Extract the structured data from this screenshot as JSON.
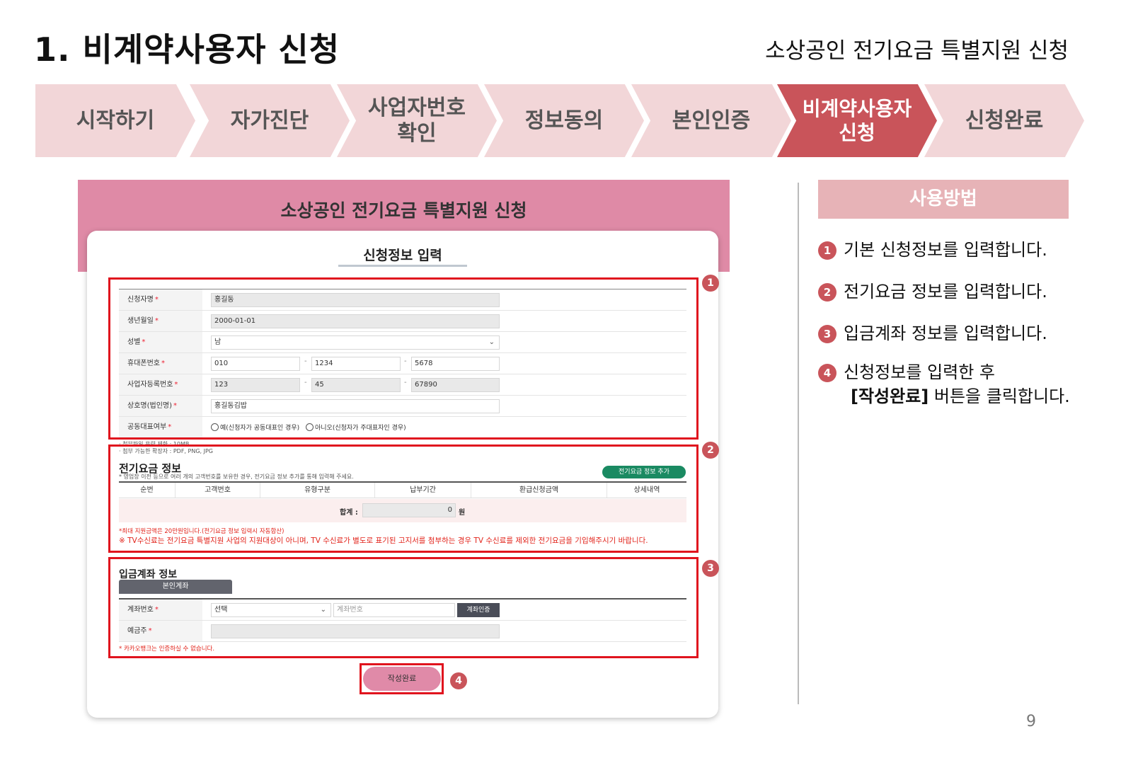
{
  "slide": {
    "title": "1. 비계약사용자 신청",
    "subtitle": "소상공인 전기요금 특별지원 신청",
    "page_number": "9"
  },
  "steps": [
    {
      "line1": "시작하기",
      "line2": "",
      "active": false
    },
    {
      "line1": "자가진단",
      "line2": "",
      "active": false
    },
    {
      "line1": "사업자번호",
      "line2": "확인",
      "active": false
    },
    {
      "line1": "정보동의",
      "line2": "",
      "active": false
    },
    {
      "line1": "본인인증",
      "line2": "",
      "active": false
    },
    {
      "line1": "비계약사용자",
      "line2": "신청",
      "active": true
    },
    {
      "line1": "신청완료",
      "line2": "",
      "active": false
    }
  ],
  "screenshot": {
    "header_title": "소상공인 전기요금 특별지원 신청",
    "card_title": "신청정보 입력",
    "applicant": {
      "name_label": "신청자명",
      "name_value": "홍길동",
      "birth_label": "생년월일",
      "birth_value": "2000-01-01",
      "gender_label": "성별",
      "gender_value": "남",
      "phone_label": "휴대폰번호",
      "phone_1": "010",
      "phone_2": "1234",
      "phone_3": "5678",
      "bizno_label": "사업자등록번호",
      "bizno_1": "123",
      "bizno_2": "45",
      "bizno_3": "67890",
      "company_label": "상호명(법인명)",
      "company_value": "홍길동김밥",
      "corep_label": "공동대표여부",
      "corep_yes": "예(신청자가 공동대표인 경우)",
      "corep_no": "아니오(신청자가 주대표자인 경우)",
      "required_mark": "*",
      "dash": "-"
    },
    "attach_notes": [
      "· 첨부파일 용량 제한 : 10MB",
      "· 첨부 가능한 확장자 : PDF, PNG, JPG"
    ],
    "electric": {
      "title": "전기요금 정보",
      "note": "* 영업장 이전 등으로 여러 개의 고객번호를 보유한 경우, 전기요금 정보 추가를 통해 입력해 주세요.",
      "add_button": "전기요금 정보 추가",
      "columns": [
        "순번",
        "고객번호",
        "유형구분",
        "납부기간",
        "환급신청금액",
        "상세내역"
      ],
      "total_label": "합계 :",
      "total_value": "0",
      "total_unit": "원",
      "max_note": "*최대 지원금액은 20만원입니다.(전기요금 정보 입력시 자동합산)",
      "tv_note": "※ TV수신료는 전기요금 특별지원 사업의 지원대상이 아니며, TV 수신료가 별도로 표기된 고지서를 첨부하는 경우 TV 수신료를 제외한 전기요금을 기입해주시기 바랍니다."
    },
    "account": {
      "title": "입금계좌 정보",
      "tab": "본인계좌",
      "number_label": "계좌번호",
      "bank_select": "선택",
      "number_placeholder": "계좌번호",
      "verify_button": "계좌인증",
      "holder_label": "예금주",
      "kakao_note": "* 카카오뱅크는 인증하실 수 없습니다."
    },
    "submit_button": "작성완료",
    "markers": [
      "1",
      "2",
      "3",
      "4"
    ]
  },
  "help": {
    "title": "사용방법",
    "items": [
      {
        "num": "1",
        "text": "기본 신청정보를 입력합니다."
      },
      {
        "num": "2",
        "text": "전기요금 정보를 입력합니다."
      },
      {
        "num": "3",
        "text": "입금계좌 정보를 입력합니다."
      },
      {
        "num": "4",
        "text": "신청정보를 입력한 후"
      }
    ],
    "item4_bold": "[작성완료]",
    "item4_rest": " 버튼을 클릭합니다."
  },
  "colors": {
    "accent": "#c9545a",
    "step_bg": "#f2d6d8",
    "header_pink": "#df8aa6",
    "highlight_red": "#e0141e",
    "green_button": "#1a8a62"
  }
}
